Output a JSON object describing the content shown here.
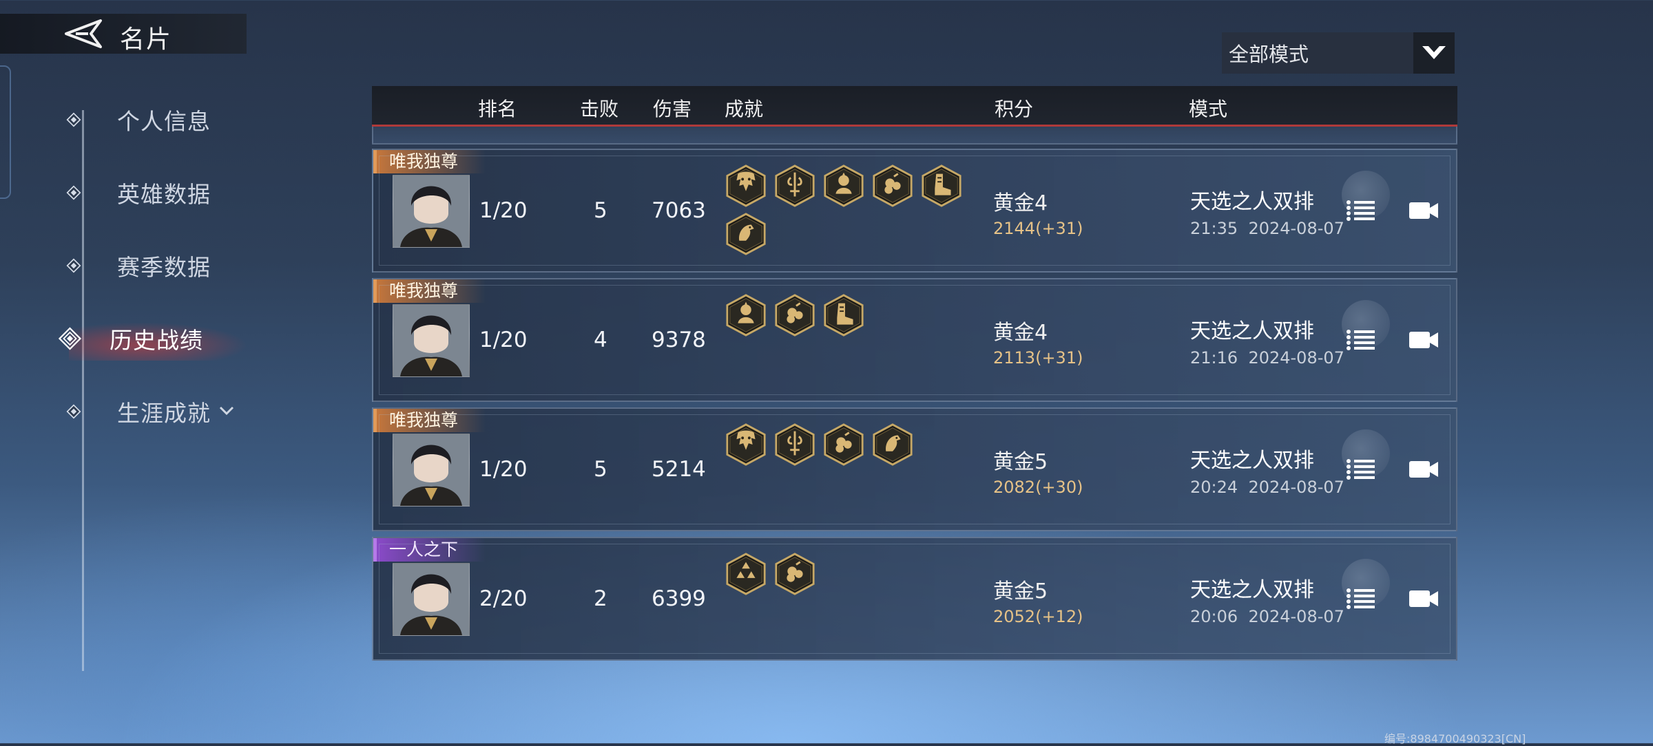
{
  "header": {
    "title": "名片",
    "back_icon": "back-arrow-icon"
  },
  "sidebar": {
    "items": [
      {
        "label": "个人信息",
        "active": false
      },
      {
        "label": "英雄数据",
        "active": false
      },
      {
        "label": "赛季数据",
        "active": false
      },
      {
        "label": "历史战绩",
        "active": true
      },
      {
        "label": "生涯成就",
        "active": false,
        "expandable": true
      }
    ]
  },
  "mode_filter": {
    "selected": "全部模式"
  },
  "table": {
    "columns": {
      "rank": "排名",
      "kills": "击败",
      "damage": "伤害",
      "achievements": "成就",
      "score": "积分",
      "mode": "模式"
    },
    "rows": [
      {
        "tag": "唯我独尊",
        "tag_color": "#c4763c",
        "rank": "1/20",
        "kills": "5",
        "damage": "7063",
        "achievements": [
          "dragon-head-icon",
          "sword-icon",
          "warrior-icon",
          "cloud-icon",
          "boot-icon",
          "horse-icon"
        ],
        "tier": "黄金4",
        "points": "2144(+31)",
        "mode": "天选之人双排",
        "time": "21:35",
        "date": "2024-08-07"
      },
      {
        "tag": "唯我独尊",
        "tag_color": "#c4763c",
        "rank": "1/20",
        "kills": "4",
        "damage": "9378",
        "achievements": [
          "warrior-icon",
          "cloud-icon",
          "boot-icon"
        ],
        "tier": "黄金4",
        "points": "2113(+31)",
        "mode": "天选之人双排",
        "time": "21:16",
        "date": "2024-08-07"
      },
      {
        "tag": "唯我独尊",
        "tag_color": "#c4763c",
        "rank": "1/20",
        "kills": "5",
        "damage": "5214",
        "achievements": [
          "dragon-head-icon",
          "sword-icon",
          "cloud-icon",
          "horse-icon"
        ],
        "tier": "黄金5",
        "points": "2082(+30)",
        "mode": "天选之人双排",
        "time": "20:24",
        "date": "2024-08-07"
      },
      {
        "tag": "一人之下",
        "tag_color": "#8a4ac8",
        "rank": "2/20",
        "kills": "2",
        "damage": "6399",
        "achievements": [
          "triple-stone-icon",
          "cloud-icon"
        ],
        "tier": "黄金5",
        "points": "2052(+12)",
        "mode": "天选之人双排",
        "time": "20:06",
        "date": "2024-08-07"
      }
    ]
  },
  "footer": {
    "id_text": "编号:8984700490323[CN]"
  },
  "colors": {
    "accent_red": "#b03a3a",
    "gold_text": "#e6c287",
    "tag_orange": "#c4763c",
    "tag_purple": "#8a4ac8"
  }
}
